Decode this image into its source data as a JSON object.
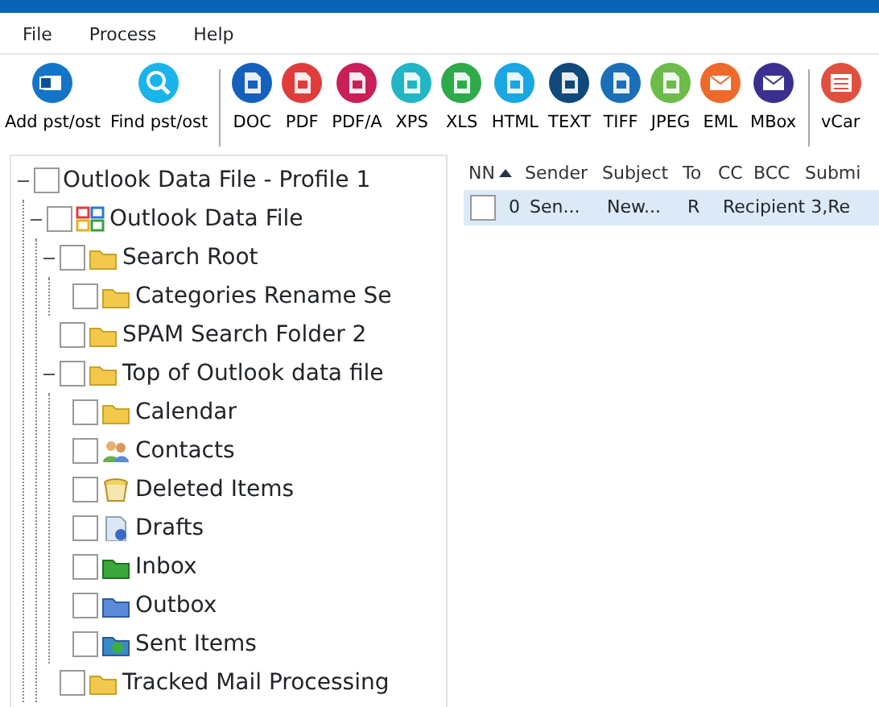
{
  "menu": [
    {
      "label": "File"
    },
    {
      "label": "Process"
    },
    {
      "label": "Help"
    }
  ],
  "toolbar": [
    {
      "label": "Add pst/ost",
      "color": "#1475c8",
      "kind": "outlook",
      "separator_before": false
    },
    {
      "label": "Find pst/ost",
      "color": "#1ab4ea",
      "kind": "search",
      "separator_before": false
    },
    {
      "label": "DOC",
      "color": "#1560bd",
      "kind": "doc",
      "separator_before": true
    },
    {
      "label": "PDF",
      "color": "#e03c3c",
      "kind": "doc",
      "separator_before": false
    },
    {
      "label": "PDF/A",
      "color": "#c81e5a",
      "kind": "doc",
      "separator_before": false
    },
    {
      "label": "XPS",
      "color": "#22b5c5",
      "kind": "doc",
      "separator_before": false
    },
    {
      "label": "XLS",
      "color": "#2eaa4a",
      "kind": "doc",
      "separator_before": false
    },
    {
      "label": "HTML",
      "color": "#1aa6e0",
      "kind": "doc",
      "separator_before": false
    },
    {
      "label": "TEXT",
      "color": "#0f4a7a",
      "kind": "doc",
      "separator_before": false
    },
    {
      "label": "TIFF",
      "color": "#1b6fb8",
      "kind": "doc",
      "separator_before": false
    },
    {
      "label": "JPEG",
      "color": "#6dbb4a",
      "kind": "doc",
      "separator_before": false
    },
    {
      "label": "EML",
      "color": "#ee6a2a",
      "kind": "mail",
      "separator_before": false
    },
    {
      "label": "MBox",
      "color": "#3b2f8f",
      "kind": "mail",
      "separator_before": false
    },
    {
      "label": "vCar",
      "color": "#e05040",
      "kind": "card",
      "separator_before": true
    }
  ],
  "tree": [
    {
      "label": "Outlook Data File - Profile 1",
      "checked": false,
      "expanded": true,
      "children": [
        {
          "label": "Outlook Data File",
          "kind": "datafile",
          "checked": false,
          "expanded": true,
          "children": [
            {
              "label": "Search Root",
              "kind": "folder",
              "checked": false,
              "expanded": true,
              "children": [
                {
                  "label": "Categories Rename Se",
                  "kind": "folder",
                  "checked": false
                }
              ]
            },
            {
              "label": "SPAM Search Folder 2",
              "kind": "folder",
              "checked": false
            },
            {
              "label": "Top of Outlook data file",
              "kind": "folder",
              "checked": false,
              "expanded": true,
              "children": [
                {
                  "label": "Calendar",
                  "kind": "folder",
                  "checked": false
                },
                {
                  "label": "Contacts",
                  "kind": "contacts",
                  "checked": false
                },
                {
                  "label": "Deleted Items",
                  "kind": "deleted",
                  "checked": false
                },
                {
                  "label": "Drafts",
                  "kind": "drafts",
                  "checked": false
                },
                {
                  "label": "Inbox",
                  "kind": "inbox",
                  "checked": false
                },
                {
                  "label": "Outbox",
                  "kind": "outbox",
                  "checked": false
                },
                {
                  "label": "Sent Items",
                  "kind": "sent",
                  "checked": false
                }
              ]
            },
            {
              "label": "Tracked Mail Processing",
              "kind": "folder",
              "checked": false
            }
          ]
        }
      ]
    }
  ],
  "table": {
    "columns": [
      {
        "label": "NN",
        "sorted": true
      },
      {
        "label": "Sender",
        "sorted": false
      },
      {
        "label": "Subject",
        "sorted": false
      },
      {
        "label": "To",
        "sorted": false
      },
      {
        "label": "CC",
        "sorted": false
      },
      {
        "label": "BCC",
        "sorted": false
      },
      {
        "label": "Submi",
        "sorted": false
      }
    ],
    "rows": [
      {
        "checked": false,
        "selected": true,
        "cells": [
          "0",
          "Sen...",
          "New...",
          "R",
          "Recipient 3,Re",
          "",
          ""
        ]
      }
    ]
  }
}
